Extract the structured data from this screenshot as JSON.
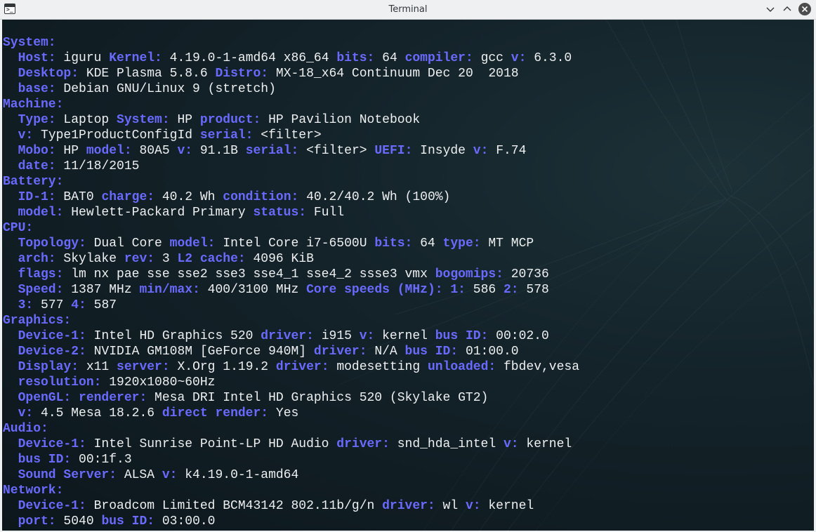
{
  "window": {
    "title": "Terminal"
  },
  "icons": {
    "app": "terminal-icon",
    "minimize": "chevron-down-icon",
    "maximize": "chevron-up-icon",
    "close": "close-icon"
  },
  "colors": {
    "background": "#0f1c22",
    "key": "#6a6aff",
    "value": "#eef0f1",
    "titlebar": "#eff0f1"
  },
  "lines": [
    [
      {
        "k": "System:"
      }
    ],
    [
      {
        "k": "  Host:"
      },
      {
        "v": " iguru "
      },
      {
        "k": "Kernel:"
      },
      {
        "v": " 4.19.0-1-amd64 x86_64 "
      },
      {
        "k": "bits:"
      },
      {
        "v": " 64 "
      },
      {
        "k": "compiler:"
      },
      {
        "v": " gcc "
      },
      {
        "k": "v:"
      },
      {
        "v": " 6.3.0"
      }
    ],
    [
      {
        "k": "  Desktop:"
      },
      {
        "v": " KDE Plasma 5.8.6 "
      },
      {
        "k": "Distro:"
      },
      {
        "v": " MX-18_x64 Continuum Dec 20  2018"
      }
    ],
    [
      {
        "k": "  base:"
      },
      {
        "v": " Debian GNU/Linux 9 (stretch)"
      }
    ],
    [
      {
        "k": "Machine:"
      }
    ],
    [
      {
        "k": "  Type:"
      },
      {
        "v": " Laptop "
      },
      {
        "k": "System:"
      },
      {
        "v": " HP "
      },
      {
        "k": "product:"
      },
      {
        "v": " HP Pavilion Notebook"
      }
    ],
    [
      {
        "v": "  "
      },
      {
        "k": "v:"
      },
      {
        "v": " Type1ProductConfigId "
      },
      {
        "k": "serial:"
      },
      {
        "v": " <filter>"
      }
    ],
    [
      {
        "k": "  Mobo:"
      },
      {
        "v": " HP "
      },
      {
        "k": "model:"
      },
      {
        "v": " 80A5 "
      },
      {
        "k": "v:"
      },
      {
        "v": " 91.1B "
      },
      {
        "k": "serial:"
      },
      {
        "v": " <filter> "
      },
      {
        "k": "UEFI:"
      },
      {
        "v": " Insyde "
      },
      {
        "k": "v:"
      },
      {
        "v": " F.74"
      }
    ],
    [
      {
        "k": "  date:"
      },
      {
        "v": " 11/18/2015"
      }
    ],
    [
      {
        "k": "Battery:"
      }
    ],
    [
      {
        "k": "  ID-1:"
      },
      {
        "v": " BAT0 "
      },
      {
        "k": "charge:"
      },
      {
        "v": " 40.2 Wh "
      },
      {
        "k": "condition:"
      },
      {
        "v": " 40.2/40.2 Wh (100%)"
      }
    ],
    [
      {
        "k": "  model:"
      },
      {
        "v": " Hewlett-Packard Primary "
      },
      {
        "k": "status:"
      },
      {
        "v": " Full"
      }
    ],
    [
      {
        "k": "CPU:"
      }
    ],
    [
      {
        "k": "  Topology:"
      },
      {
        "v": " Dual Core "
      },
      {
        "k": "model:"
      },
      {
        "v": " Intel Core i7-6500U "
      },
      {
        "k": "bits:"
      },
      {
        "v": " 64 "
      },
      {
        "k": "type:"
      },
      {
        "v": " MT MCP"
      }
    ],
    [
      {
        "k": "  arch:"
      },
      {
        "v": " Skylake "
      },
      {
        "k": "rev:"
      },
      {
        "v": " 3 "
      },
      {
        "k": "L2 cache:"
      },
      {
        "v": " 4096 KiB"
      }
    ],
    [
      {
        "k": "  flags:"
      },
      {
        "v": " lm nx pae sse sse2 sse3 sse4_1 sse4_2 ssse3 vmx "
      },
      {
        "k": "bogomips:"
      },
      {
        "v": " 20736"
      }
    ],
    [
      {
        "k": "  Speed:"
      },
      {
        "v": " 1387 MHz "
      },
      {
        "k": "min/max:"
      },
      {
        "v": " 400/3100 MHz "
      },
      {
        "k": "Core speeds (MHz):"
      },
      {
        "v": " "
      },
      {
        "k": "1:"
      },
      {
        "v": " 586 "
      },
      {
        "k": "2:"
      },
      {
        "v": " 578"
      }
    ],
    [
      {
        "v": "  "
      },
      {
        "k": "3:"
      },
      {
        "v": " 577 "
      },
      {
        "k": "4:"
      },
      {
        "v": " 587"
      }
    ],
    [
      {
        "k": "Graphics:"
      }
    ],
    [
      {
        "k": "  Device-1:"
      },
      {
        "v": " Intel HD Graphics 520 "
      },
      {
        "k": "driver:"
      },
      {
        "v": " i915 "
      },
      {
        "k": "v:"
      },
      {
        "v": " kernel "
      },
      {
        "k": "bus ID:"
      },
      {
        "v": " 00:02.0"
      }
    ],
    [
      {
        "k": "  Device-2:"
      },
      {
        "v": " NVIDIA GM108M [GeForce 940M] "
      },
      {
        "k": "driver:"
      },
      {
        "v": " N/A "
      },
      {
        "k": "bus ID:"
      },
      {
        "v": " 01:00.0"
      }
    ],
    [
      {
        "k": "  Display:"
      },
      {
        "v": " x11 "
      },
      {
        "k": "server:"
      },
      {
        "v": " X.Org 1.19.2 "
      },
      {
        "k": "driver:"
      },
      {
        "v": " modesetting "
      },
      {
        "k": "unloaded:"
      },
      {
        "v": " fbdev,vesa"
      }
    ],
    [
      {
        "k": "  resolution:"
      },
      {
        "v": " 1920x1080~60Hz"
      }
    ],
    [
      {
        "k": "  OpenGL:"
      },
      {
        "v": " "
      },
      {
        "k": "renderer:"
      },
      {
        "v": " Mesa DRI Intel HD Graphics 520 (Skylake GT2)"
      }
    ],
    [
      {
        "v": "  "
      },
      {
        "k": "v:"
      },
      {
        "v": " 4.5 Mesa 18.2.6 "
      },
      {
        "k": "direct render:"
      },
      {
        "v": " Yes"
      }
    ],
    [
      {
        "k": "Audio:"
      }
    ],
    [
      {
        "k": "  Device-1:"
      },
      {
        "v": " Intel Sunrise Point-LP HD Audio "
      },
      {
        "k": "driver:"
      },
      {
        "v": " snd_hda_intel "
      },
      {
        "k": "v:"
      },
      {
        "v": " kernel"
      }
    ],
    [
      {
        "k": "  bus ID:"
      },
      {
        "v": " 00:1f.3"
      }
    ],
    [
      {
        "k": "  Sound Server:"
      },
      {
        "v": " ALSA "
      },
      {
        "k": "v:"
      },
      {
        "v": " k4.19.0-1-amd64"
      }
    ],
    [
      {
        "k": "Network:"
      }
    ],
    [
      {
        "k": "  Device-1:"
      },
      {
        "v": " Broadcom Limited BCM43142 802.11b/g/n "
      },
      {
        "k": "driver:"
      },
      {
        "v": " wl "
      },
      {
        "k": "v:"
      },
      {
        "v": " kernel"
      }
    ],
    [
      {
        "k": "  port:"
      },
      {
        "v": " 5040 "
      },
      {
        "k": "bus ID:"
      },
      {
        "v": " 03:00.0"
      }
    ]
  ]
}
